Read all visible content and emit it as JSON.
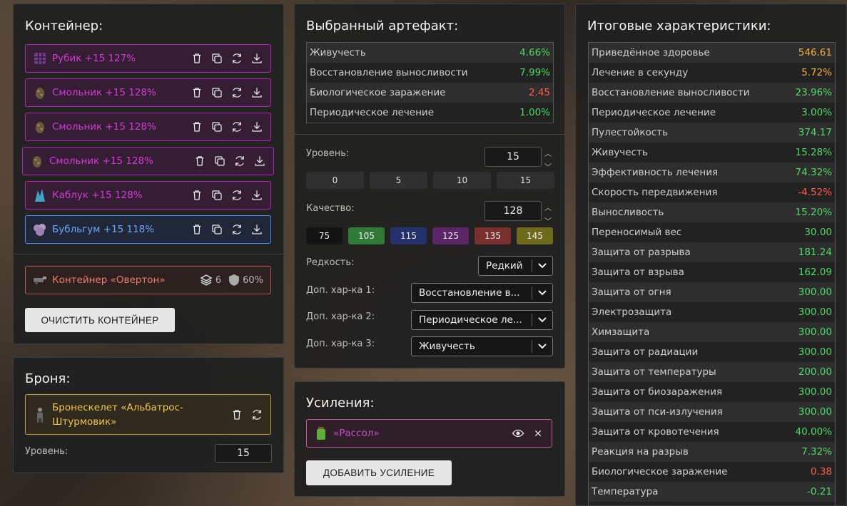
{
  "container": {
    "title": "Контейнер:",
    "items": [
      {
        "label": "Рубик +15 127%",
        "icon": "rubik-artifact-icon"
      },
      {
        "label": "Смольник +15 128%",
        "icon": "smolnik-artifact-icon"
      },
      {
        "label": "Смольник +15 128%",
        "icon": "smolnik-artifact-icon"
      },
      {
        "label": "Смольник +15 128%",
        "icon": "smolnik-artifact-icon"
      },
      {
        "label": "Каблук +15 128%",
        "icon": "kabluk-artifact-icon"
      },
      {
        "label": "Бубльгум +15 118%",
        "icon": "bublgum-artifact-icon"
      }
    ],
    "overton": {
      "label": "Контейнер «Овертон»",
      "slots": "6",
      "protection": "60%"
    },
    "clear_button": "ОЧИСТИТЬ КОНТЕЙНЕР"
  },
  "armor": {
    "title": "Броня:",
    "name": "Бронескелет «Альбатрос-Штурмовик»",
    "level_label": "Уровень:",
    "level_value": "15"
  },
  "artifact": {
    "title": "Выбранный артефакт:",
    "stats": [
      {
        "name": "Живучесть",
        "value": "4.66%",
        "tone": "green"
      },
      {
        "name": "Восстановление выносливости",
        "value": "7.99%",
        "tone": "green"
      },
      {
        "name": "Биологическое заражение",
        "value": "2.45",
        "tone": "red"
      },
      {
        "name": "Периодическое лечение",
        "value": "1.00%",
        "tone": "green"
      }
    ],
    "level_label": "Уровень:",
    "level_value": "15",
    "level_presets": [
      "0",
      "5",
      "10",
      "15"
    ],
    "quality_label": "Качество:",
    "quality_value": "128",
    "quality_presets": [
      {
        "label": "75",
        "color": "#141414"
      },
      {
        "label": "105",
        "color": "#2f7a36"
      },
      {
        "label": "115",
        "color": "#23306b"
      },
      {
        "label": "125",
        "color": "#5b2466"
      },
      {
        "label": "135",
        "color": "#7a2f2f"
      },
      {
        "label": "145",
        "color": "#6e6a1c"
      }
    ],
    "rarity_label": "Редкость:",
    "rarity_value": "Редкий",
    "extra1_label": "Доп. хар-ка 1:",
    "extra1_value": "Восстановление в...",
    "extra2_label": "Доп. хар-ка 2:",
    "extra2_value": "Периодическое ле...",
    "extra3_label": "Доп. хар-ка 3:",
    "extra3_value": "Живучесть"
  },
  "boosts": {
    "title": "Усиления:",
    "item": "«Рассол»",
    "add_button": "ДОБАВИТЬ УСИЛЕНИЕ"
  },
  "totals": {
    "title": "Итоговые характеристики:",
    "stats": [
      {
        "name": "Приведённое здоровье",
        "value": "546.61",
        "tone": "orange"
      },
      {
        "name": "Лечение в секунду",
        "value": "5.72%",
        "tone": "orange"
      },
      {
        "name": "Восстановление выносливости",
        "value": "23.96%",
        "tone": "green"
      },
      {
        "name": "Периодическое лечение",
        "value": "3.00%",
        "tone": "green"
      },
      {
        "name": "Пулестойкость",
        "value": "374.17",
        "tone": "green"
      },
      {
        "name": "Живучесть",
        "value": "15.28%",
        "tone": "green"
      },
      {
        "name": "Эффективность лечения",
        "value": "74.32%",
        "tone": "green"
      },
      {
        "name": "Скорость передвижения",
        "value": "-4.52%",
        "tone": "red"
      },
      {
        "name": "Выносливость",
        "value": "15.20%",
        "tone": "green"
      },
      {
        "name": "Переносимый вес",
        "value": "30.00",
        "tone": "green"
      },
      {
        "name": "Защита от разрыва",
        "value": "181.24",
        "tone": "green"
      },
      {
        "name": "Защита от взрыва",
        "value": "162.09",
        "tone": "green"
      },
      {
        "name": "Защита от огня",
        "value": "300.00",
        "tone": "green"
      },
      {
        "name": "Электрозащита",
        "value": "300.00",
        "tone": "green"
      },
      {
        "name": "Химзащита",
        "value": "300.00",
        "tone": "green"
      },
      {
        "name": "Защита от радиации",
        "value": "300.00",
        "tone": "green"
      },
      {
        "name": "Защита от температуры",
        "value": "200.00",
        "tone": "green"
      },
      {
        "name": "Защита от биозаражения",
        "value": "300.00",
        "tone": "green"
      },
      {
        "name": "Защита от пси-излучения",
        "value": "300.00",
        "tone": "green"
      },
      {
        "name": "Защита от кровотечения",
        "value": "40.00%",
        "tone": "green"
      },
      {
        "name": "Реакция на разрыв",
        "value": "7.32%",
        "tone": "green"
      },
      {
        "name": "Биологическое заражение",
        "value": "0.38",
        "tone": "red"
      },
      {
        "name": "Температура",
        "value": "-0.21",
        "tone": "green"
      }
    ]
  }
}
